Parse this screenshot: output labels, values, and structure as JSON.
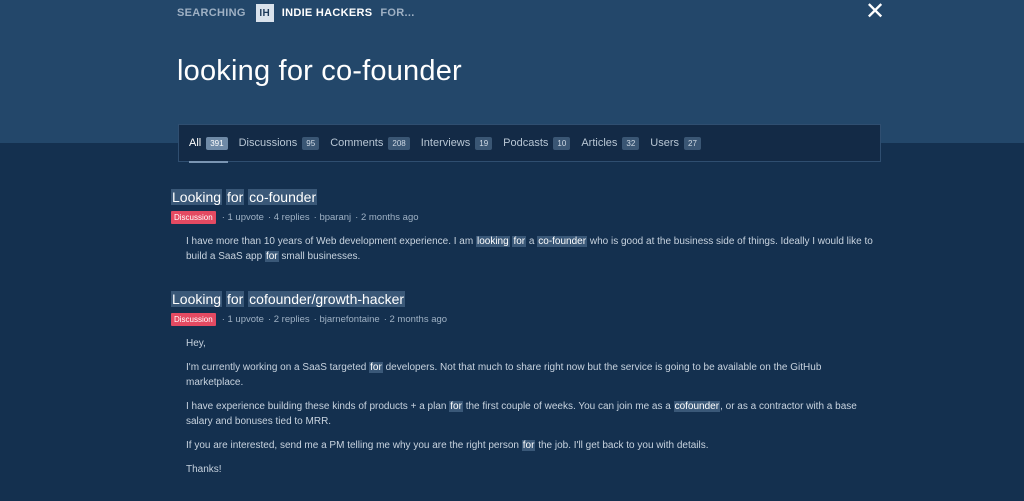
{
  "header": {
    "searching_label": "SEARCHING",
    "logo_text": "IH",
    "brand": "INDIE HACKERS",
    "for_label": "FOR...",
    "close_symbol": "✕",
    "query": "looking for co-founder"
  },
  "tabs": [
    {
      "label": "All",
      "count": "391",
      "active": true
    },
    {
      "label": "Discussions",
      "count": "95"
    },
    {
      "label": "Comments",
      "count": "208"
    },
    {
      "label": "Interviews",
      "count": "19"
    },
    {
      "label": "Podcasts",
      "count": "10"
    },
    {
      "label": "Articles",
      "count": "32"
    },
    {
      "label": "Users",
      "count": "27"
    }
  ],
  "results": [
    {
      "title_parts": [
        "Looking",
        "for",
        "co-founder"
      ],
      "badge": "Discussion",
      "meta": [
        "· 1 upvote",
        "· 4 replies",
        "· bparanj",
        "· 2 months ago"
      ],
      "body": {
        "p1_a": "I have more than 10 years of Web development experience. I am",
        "p1_hl1": "looking",
        "p1_hl2": "for",
        "p1_b": "a",
        "p1_hl3": "co-founder",
        "p1_c": "who is good at the business side of things. Ideally I would like to build a SaaS app",
        "p1_hl4": "for",
        "p1_d": "small businesses."
      }
    },
    {
      "title_parts": [
        "Looking",
        "for",
        "cofounder/growth-hacker"
      ],
      "badge": "Discussion",
      "meta": [
        "· 1 upvote",
        "· 2 replies",
        "· bjarnefontaine",
        "· 2 months ago"
      ],
      "body": {
        "p1": "Hey,",
        "p2_a": "I'm currently working on a SaaS targeted",
        "p2_hl": "for",
        "p2_b": "developers. Not that much to share right now but the service is going to be available on the GitHub marketplace.",
        "p3_a": "I have experience building these kinds of products + a plan",
        "p3_hl1": "for",
        "p3_b": "the first couple of weeks. You can join me as a",
        "p3_hl2": "cofounder",
        "p3_c": ", or as a contractor with a base salary and bonuses tied to MRR.",
        "p4_a": "If you are interested, send me a PM telling me why you are the right person",
        "p4_hl": "for",
        "p4_b": "the job. I'll get back to you with details.",
        "p5": "Thanks!"
      }
    }
  ],
  "colors": {
    "header_bg": "#23476a",
    "page_bg": "#14304f",
    "badge": "#e44a62",
    "highlight": "#3a5878"
  }
}
